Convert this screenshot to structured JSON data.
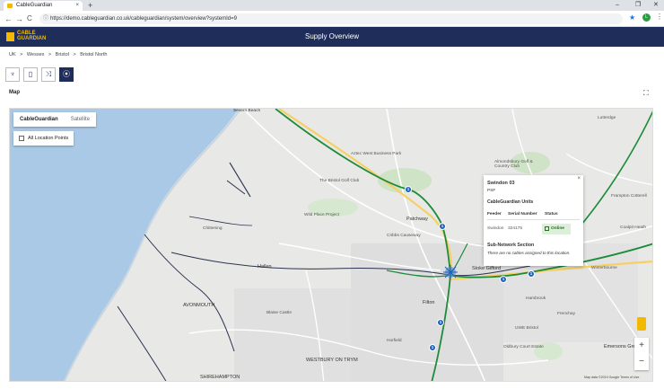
{
  "browser": {
    "tab_title": "CableGuardian",
    "tab_close": "×",
    "new_tab": "+",
    "url": "https://demo.cableguardian.co.uk/cableguardian/system/overview?systemId=9",
    "back": "←",
    "forward": "→",
    "reload": "C",
    "lock": "ⓘ",
    "star": "★",
    "profile_initial": "L",
    "menu": "⋮",
    "minimize": "–",
    "maximize": "❐",
    "close": "✕"
  },
  "app": {
    "logo_line1": "CABLE",
    "logo_line2": "GUARDIAN",
    "page_title": "Supply Overview",
    "brand_color": "#1f2d5a",
    "accent_color": "#f2b900"
  },
  "breadcrumbs": [
    "UK",
    ">",
    "Wessex",
    ">",
    "Bristol",
    ">",
    "Bristol North"
  ],
  "toolbar": {
    "icons": [
      "plug-icon",
      "battery-icon",
      "network-icon",
      "map-pin-icon"
    ],
    "glyphs": [
      "♆",
      "▯",
      "⤨",
      "⦿"
    ],
    "active_index": 3
  },
  "map_section": {
    "title": "Map",
    "expand_glyph": "⛶"
  },
  "map": {
    "type_options": [
      "CableGuardian",
      "Satellite"
    ],
    "selected_type": "CableGuardian",
    "location_points_label": "All Location Points",
    "location_points_checked": false,
    "places": [
      {
        "label": "Severn Beach",
        "style": "dark"
      },
      {
        "label": "Aztec West Business Park",
        "style": ""
      },
      {
        "label": "The Bristol Golf Club",
        "style": ""
      },
      {
        "label": "Almondsbury Golf & Country Club",
        "style": ""
      },
      {
        "label": "Wild Place Project",
        "style": ""
      },
      {
        "label": "Patchway",
        "style": "big"
      },
      {
        "label": "Cribbs Causeway",
        "style": ""
      },
      {
        "label": "Chittening",
        "style": ""
      },
      {
        "label": "Hallen",
        "style": "big"
      },
      {
        "label": "AVONMOUTH",
        "style": "big"
      },
      {
        "label": "Filton",
        "style": "big"
      },
      {
        "label": "Stoke Gifford",
        "style": "big"
      },
      {
        "label": "Frampton Cotterell",
        "style": ""
      },
      {
        "label": "Winterbourne",
        "style": ""
      },
      {
        "label": "Lutterdge",
        "style": ""
      },
      {
        "label": "Hambrook",
        "style": ""
      },
      {
        "label": "Frenchay",
        "style": ""
      },
      {
        "label": "WESTBURY ON TRYM",
        "style": "big"
      },
      {
        "label": "SHIREHAMPTON",
        "style": "big"
      },
      {
        "label": "Blaise Castle",
        "style": ""
      },
      {
        "label": "Emersons Green",
        "style": "big"
      },
      {
        "label": "Oldbury Court Estate",
        "style": ""
      },
      {
        "label": "Coalpit Heath",
        "style": ""
      },
      {
        "label": "Horfield",
        "style": ""
      },
      {
        "label": "UWE Bristol",
        "style": ""
      }
    ],
    "markers": [
      "1",
      "1",
      "1",
      "1",
      "1",
      "1"
    ],
    "attribution": "Map data ©2019 Google   Terms of Use",
    "zoom_in": "+",
    "zoom_out": "−"
  },
  "popup": {
    "name": "Swindon 03",
    "code": "PSF",
    "units_title": "CableGuardian Units",
    "headers": [
      "Feeder",
      "Serial Number",
      "Status"
    ],
    "row": {
      "feeder": "Swindon",
      "serial": "324175",
      "status": "Online"
    },
    "status_color": "#dcefd9",
    "subnet_title": "Sub-Network Section",
    "no_cables": "There are no cables assigned to this location.",
    "close": "×"
  }
}
